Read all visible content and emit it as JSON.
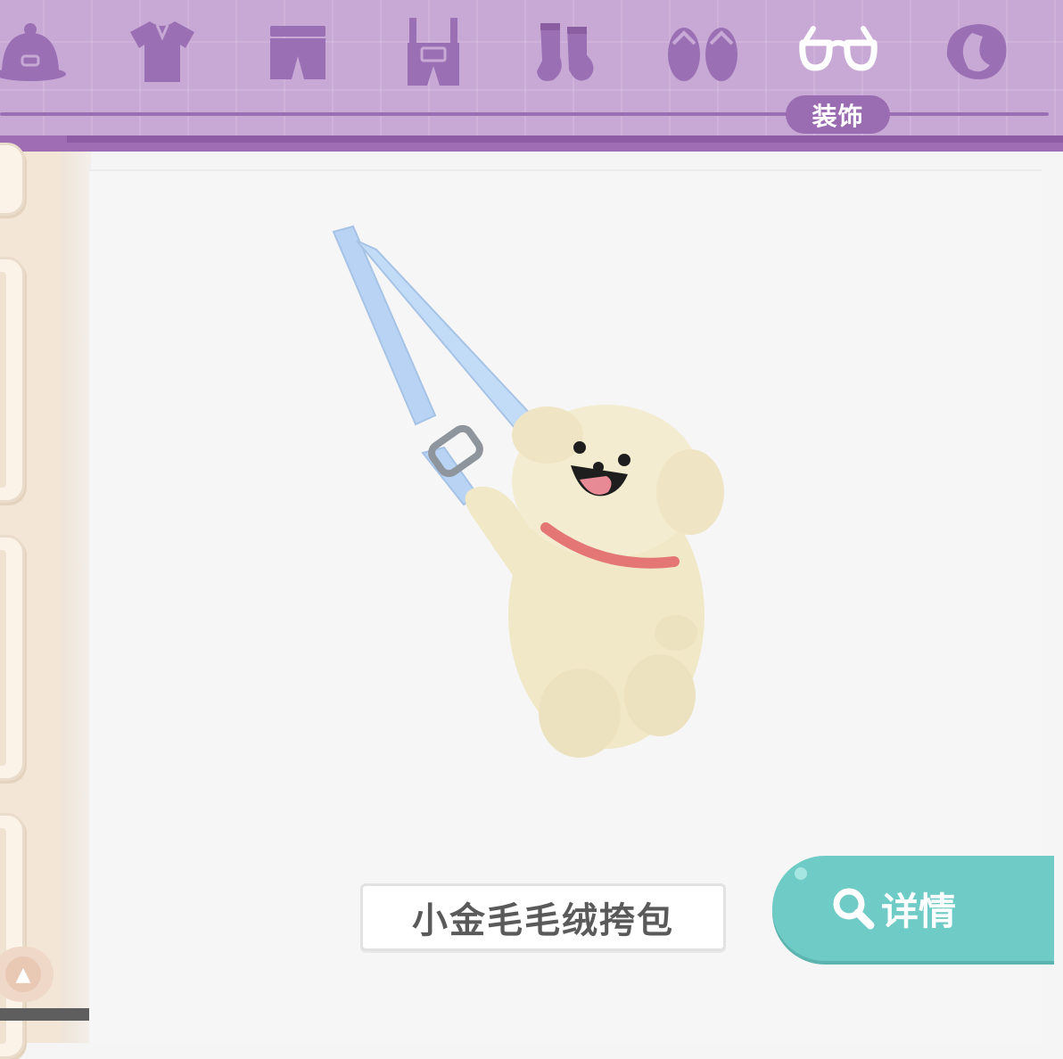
{
  "categories": [
    {
      "id": "hat",
      "icon": "hat-icon",
      "selected": false
    },
    {
      "id": "top",
      "icon": "tshirt-icon",
      "selected": false
    },
    {
      "id": "bottoms",
      "icon": "shorts-icon",
      "selected": false
    },
    {
      "id": "overalls",
      "icon": "overalls-icon",
      "selected": false
    },
    {
      "id": "socks",
      "icon": "socks-icon",
      "selected": false
    },
    {
      "id": "shoes",
      "icon": "flip-flops-icon",
      "selected": false
    },
    {
      "id": "accessories",
      "icon": "glasses-icon",
      "selected": true,
      "label": "装饰"
    },
    {
      "id": "hair",
      "icon": "hair-icon",
      "selected": false
    }
  ],
  "selected_category_label": "装饰",
  "item": {
    "name": "小金毛毛绒挎包",
    "preview": "golden-puppy-plush-crossbody-bag"
  },
  "details_button": {
    "label": "详情",
    "icon": "magnifier-icon"
  },
  "colors": {
    "topbar": "#c8a9d6",
    "category_icon": "#9b6fb3",
    "selected_icon": "#ffffff",
    "details_button": "#6fcbc6",
    "plush": "#f1e8c8",
    "strap": "#b9d4f3",
    "collar": "#e47676"
  }
}
